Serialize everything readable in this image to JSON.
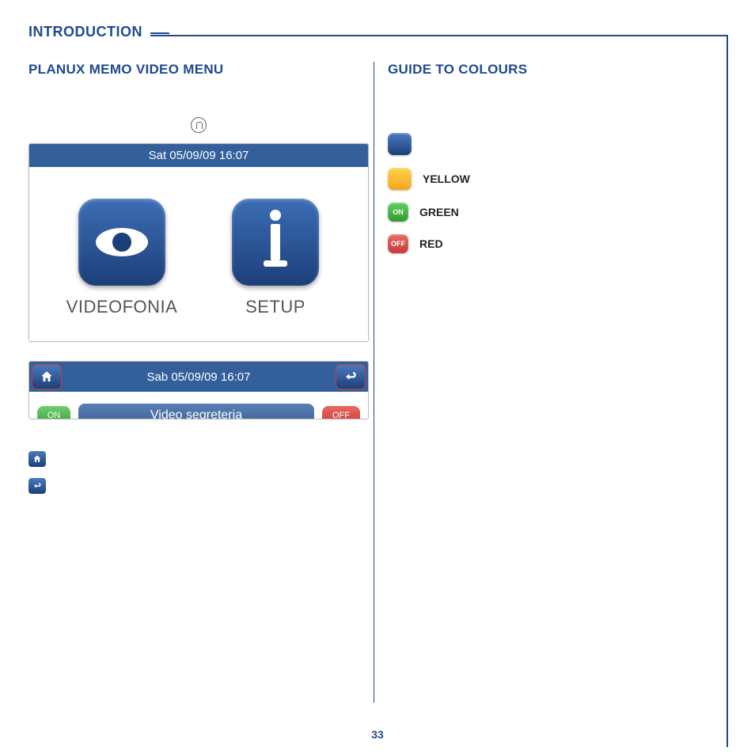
{
  "section_title": "INTRODUCTION",
  "left": {
    "heading": "PLANUX MEMO VIDEO MENU",
    "screen1": {
      "titlebar": "Sat 05/09/09 16:07",
      "apps": [
        {
          "label": "VIDEOFONIA"
        },
        {
          "label": "SETUP"
        }
      ]
    },
    "screen2": {
      "titlebar": "Sab 05/09/09 16:07",
      "on_label": "ON",
      "item_label": "Video segreteria",
      "off_label": "OFF"
    }
  },
  "right": {
    "heading": "GUIDE TO COLOURS",
    "swatches": [
      {
        "color": "blue",
        "text": "",
        "label": ""
      },
      {
        "color": "yellow",
        "text": "",
        "label": "YELLOW"
      },
      {
        "color": "green",
        "text": "ON",
        "label": "GREEN"
      },
      {
        "color": "red",
        "text": "OFF",
        "label": "RED"
      }
    ]
  },
  "page_number": "33"
}
